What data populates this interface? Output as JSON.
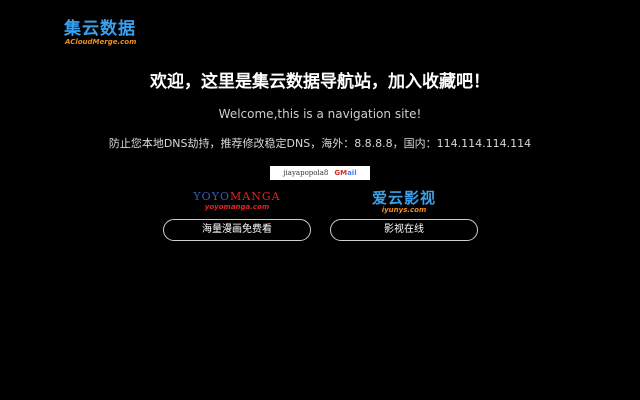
{
  "logo": {
    "cn": "集云数据",
    "en": "ACloudMerge.com"
  },
  "headline": "欢迎，这里是集云数据导航站，加入收藏吧！",
  "subline": "Welcome,this is a navigation site!",
  "dns": "防止您本地DNS劫持，推荐修改稳定DNS，海外：8.8.8.8，国内：114.114.114.114",
  "email": {
    "user": "jiayapopola8",
    "provider_a": "GM",
    "provider_b": "ail"
  },
  "sites": [
    {
      "logo_a": "YOYO",
      "logo_b": "MANGA",
      "url": "yoyomanga.com",
      "button": "海量漫画免费看"
    },
    {
      "logo": "爱云影视",
      "url": "iyunys.com",
      "button": "影视在线"
    }
  ],
  "colors": {
    "background": "#000000",
    "brand_blue": "#3aa0ec",
    "brand_orange": "#f28c1e",
    "manga_red": "#e02424"
  }
}
